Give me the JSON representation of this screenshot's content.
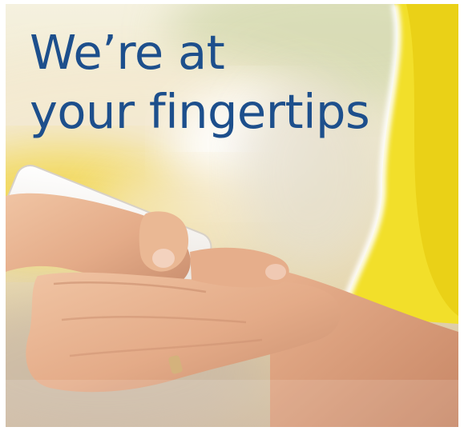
{
  "headline": {
    "line1": "We’re at",
    "line2": "your fingertips"
  },
  "palette": {
    "headline_color": "#1d4f8c",
    "accent_yellow": "#f2df2a",
    "skin_tone": "#e8b493",
    "phone_white": "#f6f3ee"
  },
  "photo": {
    "icon": "hands-holding-smartphone"
  }
}
